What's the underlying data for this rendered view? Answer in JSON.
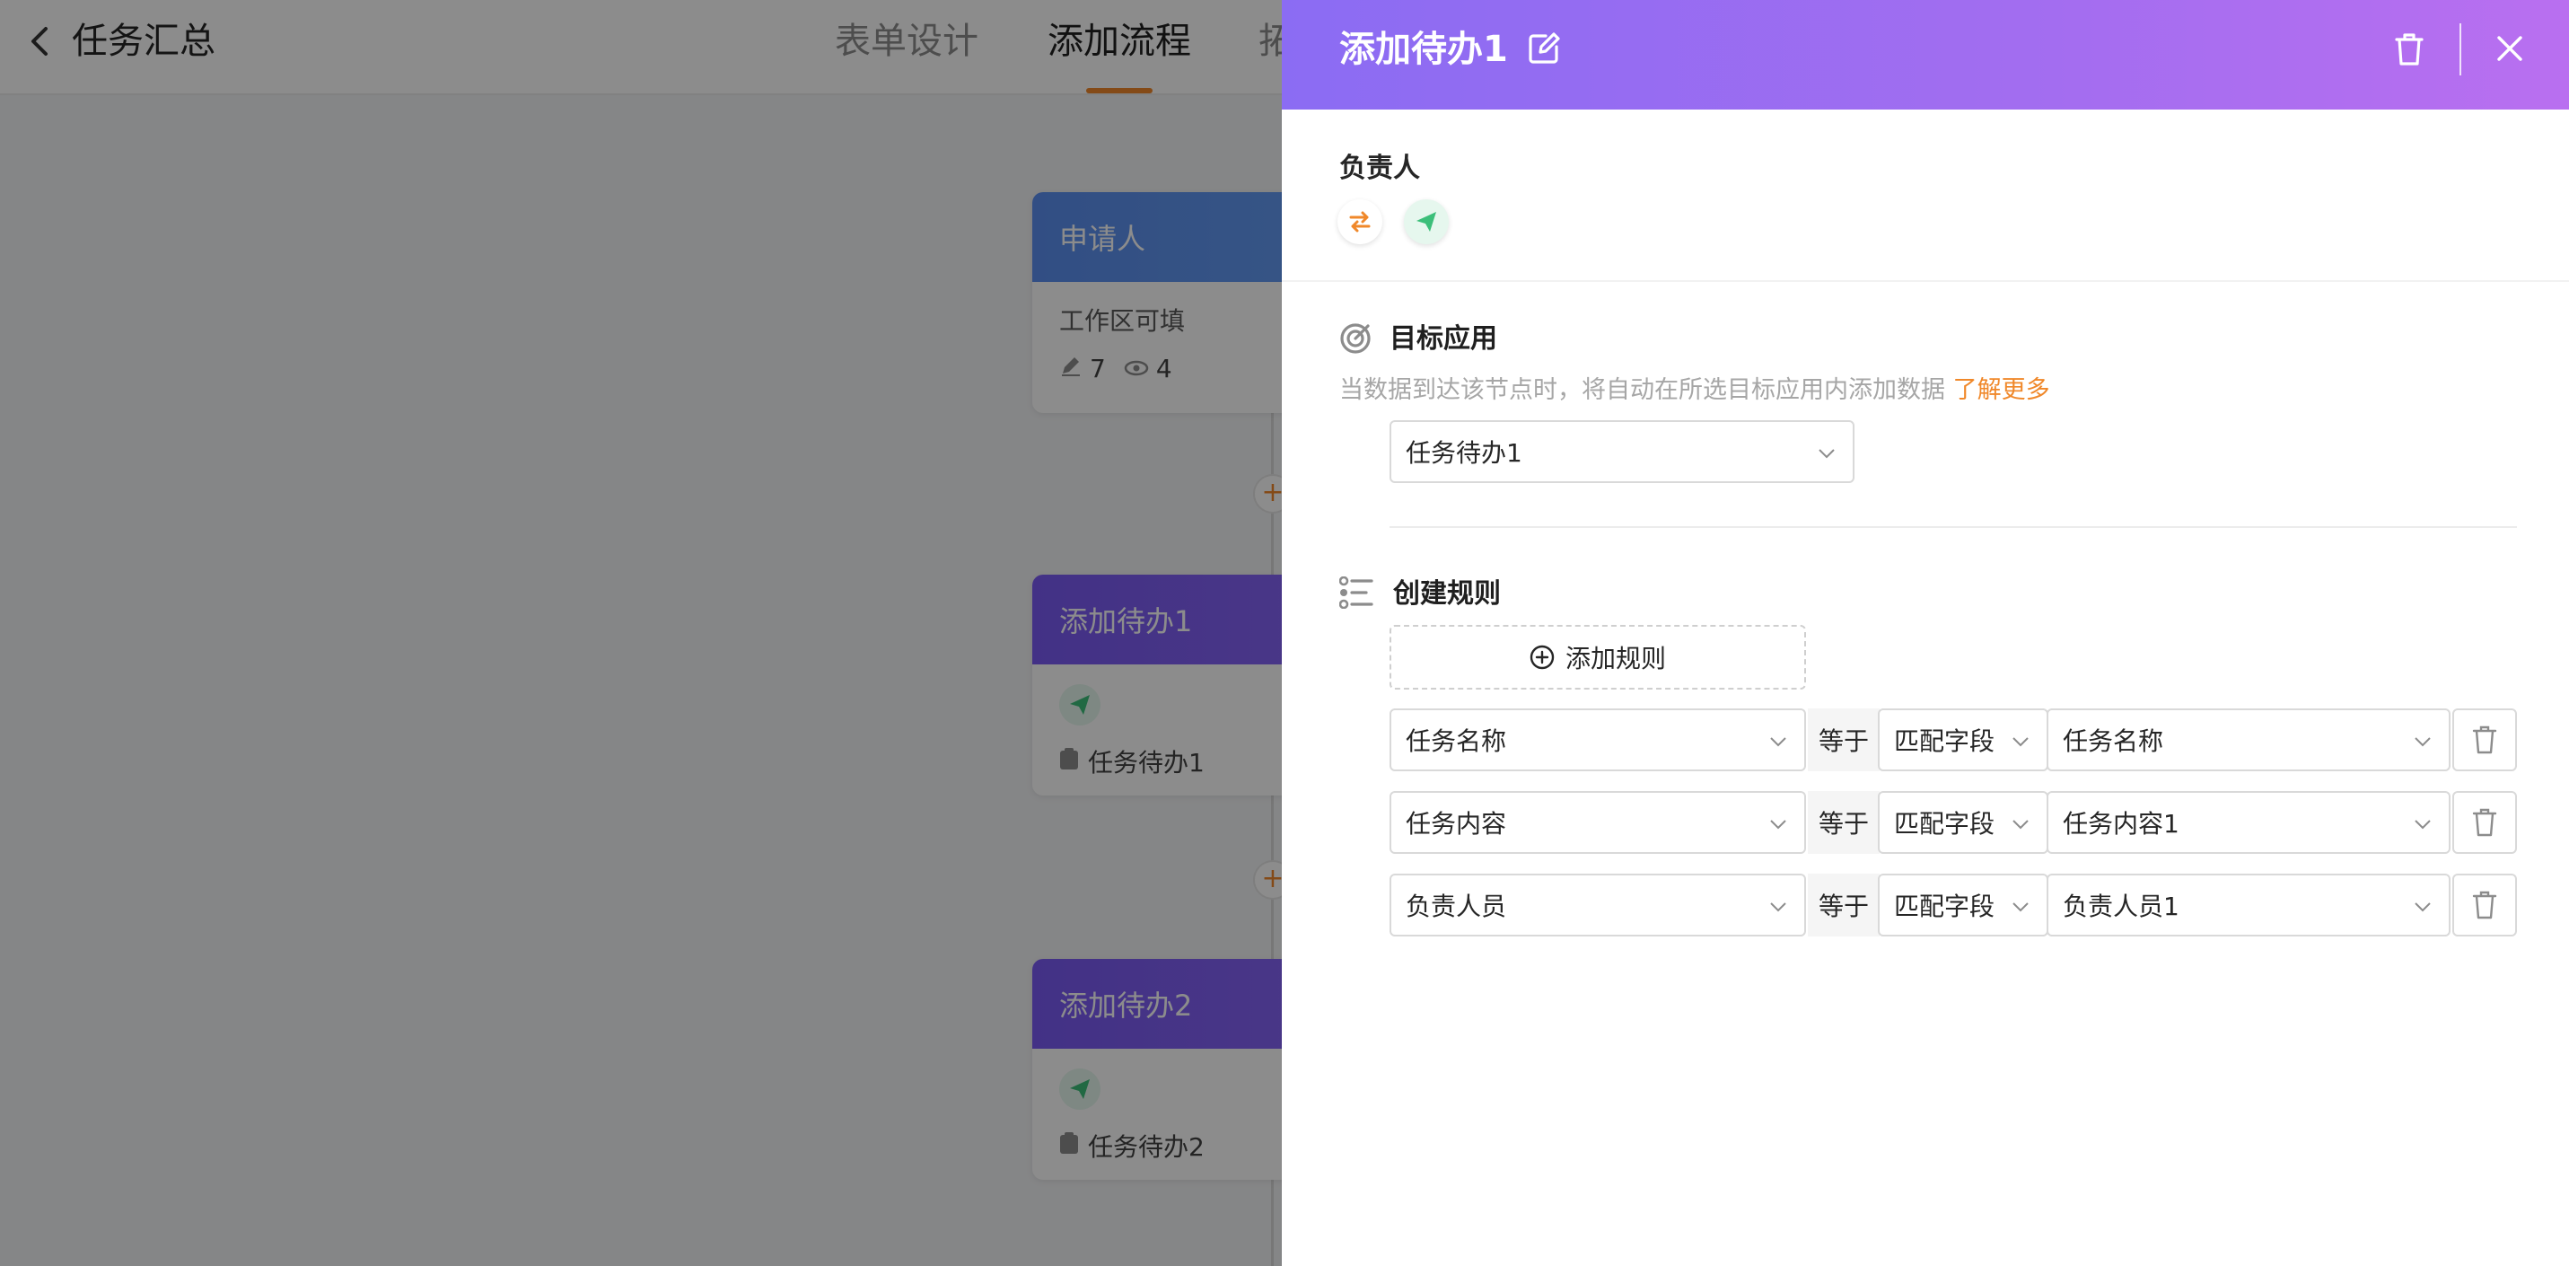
{
  "background": {
    "page_title": "任务汇总",
    "tabs": [
      {
        "label": "表单设计",
        "active": false
      },
      {
        "label": "添加流程",
        "active": true
      },
      {
        "label": "拓",
        "active": false
      }
    ],
    "cards": [
      {
        "title": "申请人",
        "subtitle": "工作区可填",
        "edit_count": "7",
        "view_count": "4"
      },
      {
        "title": "添加待办1",
        "todo": "任务待办1"
      },
      {
        "title": "添加待办2",
        "todo": "任务待办2"
      }
    ],
    "plus_symbol": "+"
  },
  "drawer": {
    "title": "添加待办1",
    "owner_label": "负责人",
    "target": {
      "title": "目标应用",
      "hint": "当数据到达该节点时，将自动在所选目标应用内添加数据",
      "hint_link": "了解更多",
      "selected_app": "任务待办1"
    },
    "rules": {
      "title": "创建规则",
      "add_label": "添加规则",
      "rows": [
        {
          "field": "任务名称",
          "operator": "等于",
          "mode": "匹配字段",
          "value": "任务名称"
        },
        {
          "field": "任务内容",
          "operator": "等于",
          "mode": "匹配字段",
          "value": "任务内容1"
        },
        {
          "field": "负责人员",
          "operator": "等于",
          "mode": "匹配字段",
          "value": "负责人员1"
        }
      ]
    }
  },
  "colors": {
    "accent_orange": "#f0882a",
    "header_purple": "#8b6cf3",
    "send_green": "#3cbf7a"
  }
}
